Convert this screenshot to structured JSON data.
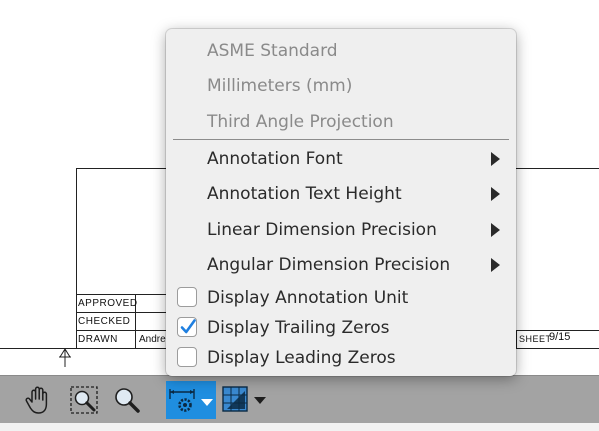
{
  "title_block": {
    "approved_label": "APPROVED",
    "checked_label": "CHECKED",
    "drawn_label": "DRAWN",
    "drawn_value": "Andre",
    "sheet_label": "SHEET",
    "sheet_value": "9/15"
  },
  "menu": {
    "headers": [
      "ASME Standard",
      "Millimeters (mm)",
      "Third Angle Projection"
    ],
    "submenus": [
      "Annotation Font",
      "Annotation Text Height",
      "Linear Dimension Precision",
      "Angular Dimension Precision"
    ],
    "options": [
      {
        "label": "Display Annotation Unit",
        "checked": false
      },
      {
        "label": "Display Trailing Zeros",
        "checked": true
      },
      {
        "label": "Display Leading Zeros",
        "checked": false
      }
    ]
  },
  "toolbar": {
    "tools": [
      {
        "icon": "pan-hand-icon",
        "active": false
      },
      {
        "icon": "zoom-window-icon",
        "active": false
      },
      {
        "icon": "zoom-icon",
        "active": false
      },
      {
        "icon": "drawing-settings-icon",
        "active": true
      },
      {
        "icon": "sheet-settings-icon",
        "active": false
      }
    ]
  },
  "colors": {
    "accent": "#1f8ee0",
    "menu_bg": "#efefef",
    "toolbar_bg": "#a3a3a3",
    "header_text": "#8a8a8a"
  }
}
